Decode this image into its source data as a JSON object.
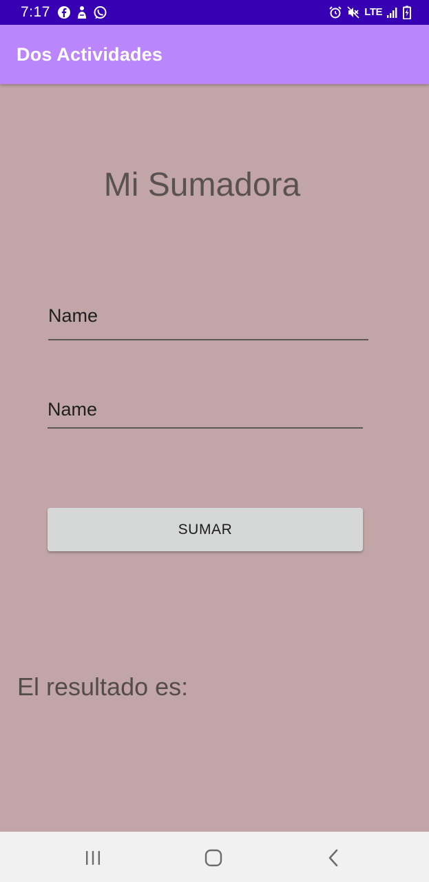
{
  "status_bar": {
    "time": "7:17",
    "left_icons": [
      "facebook-icon",
      "notification-icon",
      "whatsapp-icon"
    ],
    "network": "LTE",
    "right_icons": [
      "alarm-icon",
      "mute-icon",
      "signal-icon",
      "battery-icon"
    ]
  },
  "app_bar": {
    "title": "Dos Actividades"
  },
  "main": {
    "title": "Mi Sumadora",
    "field_1_hint": "Name",
    "field_2_hint": "Name",
    "button_label": "SUMAR",
    "result_label": "El resultado es:"
  },
  "nav_bar": {
    "buttons": [
      "recents-icon",
      "home-icon",
      "back-icon"
    ]
  },
  "colors": {
    "status_bar": "#3700b3",
    "app_bar": "#bb86fc",
    "background": "#c2a5a6",
    "button": "#d6d7d7",
    "nav_bar": "#f1f1f1"
  }
}
